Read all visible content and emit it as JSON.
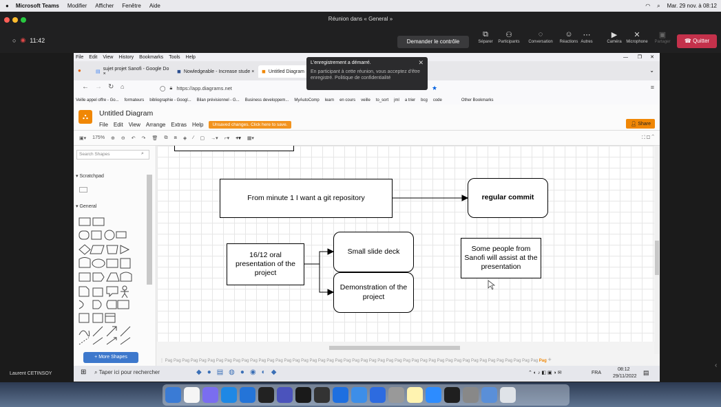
{
  "mac_menubar": {
    "app": "Microsoft Teams",
    "items": [
      "Modifier",
      "Afficher",
      "Fenêtre",
      "Aide"
    ],
    "datetime": "Mar. 29 nov. à 08:12"
  },
  "teams": {
    "title": "Réunion dans « General »",
    "elapsed": "11:42",
    "control_label": "Demander le contrôle",
    "buttons": [
      "Séparer",
      "Participants",
      "Conversation",
      "Réactions",
      "Autres",
      "Caméra",
      "Microphone",
      "Partager"
    ],
    "quit_label": "Quitter",
    "presenter": "Laurent CETINSOY"
  },
  "toast": {
    "title": "L'enregistrement a démarré.",
    "message": "En participant à cette réunion, vous acceptez d'être enregistré. Politique de confidentialité"
  },
  "browser": {
    "menu": [
      "File",
      "Edit",
      "View",
      "History",
      "Bookmarks",
      "Tools",
      "Help"
    ],
    "tabs": [
      {
        "label": "sujet projet Sanofi - Google Do ×"
      },
      {
        "label": "Nowledgeable - Increase stude ×"
      },
      {
        "label": "Untitled Diagram"
      }
    ],
    "url": "https://app.diagrams.net",
    "bookmarks": [
      "Veille appel offre - Go...",
      "formateurs",
      "bibliographie - Googl...",
      "Bilan prévisionnel - G...",
      "Business developpem...",
      "MyAutoComp",
      "learn",
      "en cours",
      "veille",
      "to_sort",
      "jml",
      "a trier",
      "bcg",
      "code",
      "Other Bookmarks"
    ]
  },
  "drawio": {
    "title": "Untitled Diagram",
    "menu": [
      "File",
      "Edit",
      "View",
      "Arrange",
      "Extras",
      "Help"
    ],
    "unsaved": "Unsaved changes. Click here to save.",
    "share": "Share",
    "zoom": "175%",
    "search_placeholder": "Search Shapes",
    "scratchpad": "Scratchpad",
    "general": "General",
    "more_shapes": "+ More Shapes",
    "page_tab": "Pag",
    "page_tab_active": "Pag"
  },
  "diagram": {
    "box_git": "From minute 1 I want a git repository",
    "box_commit": "regular commit",
    "box_oral": "16/12 oral presentation of the project",
    "box_slides": "Small slide deck",
    "box_demo": "Demonstration of the project",
    "box_sanofi": "Some people from Sanofi will assist at the presentation"
  },
  "windows_taskbar": {
    "search": "Taper ici pour rechercher",
    "lang": "FRA",
    "time": "08:12",
    "date": "29/11/2022"
  },
  "colors": {
    "drawio_orange": "#f08705",
    "quit_red": "#c4314b",
    "more_shapes_blue": "#3d78cc"
  }
}
